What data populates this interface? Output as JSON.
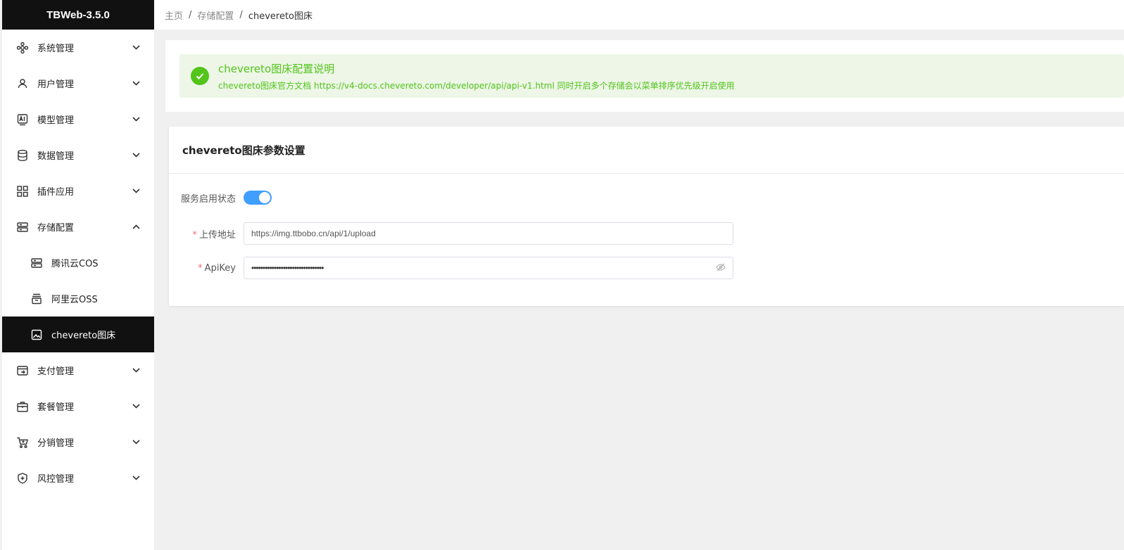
{
  "app": {
    "title": "TBWeb-3.5.0"
  },
  "sidebar": {
    "items": [
      {
        "label": "系统管理",
        "icon": "system-icon"
      },
      {
        "label": "用户管理",
        "icon": "user-icon"
      },
      {
        "label": "模型管理",
        "icon": "ai-model-icon"
      },
      {
        "label": "数据管理",
        "icon": "database-icon"
      },
      {
        "label": "插件应用",
        "icon": "grid-icon"
      },
      {
        "label": "存储配置",
        "icon": "storage-icon",
        "expanded": true,
        "children": [
          {
            "label": "腾讯云COS",
            "icon": "server-icon"
          },
          {
            "label": "阿里云OSS",
            "icon": "archive-icon"
          },
          {
            "label": "chevereto图床",
            "icon": "image-icon",
            "active": true
          }
        ]
      },
      {
        "label": "支付管理",
        "icon": "payment-icon"
      },
      {
        "label": "套餐管理",
        "icon": "package-icon"
      },
      {
        "label": "分销管理",
        "icon": "cart-icon"
      },
      {
        "label": "风控管理",
        "icon": "shield-icon"
      }
    ]
  },
  "breadcrumb": {
    "items": [
      "主页",
      "存储配置",
      "chevereto图床"
    ],
    "separator": "/"
  },
  "alert": {
    "title": "chevereto图床配置说明",
    "description": "chevereto图床官方文档 https://v4-docs.chevereto.com/developer/api/api-v1.html 同时开启多个存储会以菜单排序优先级开启使用",
    "color": "#52c41a"
  },
  "card": {
    "title": "chevereto图床参数设置",
    "fields": {
      "status": {
        "label": "服务启用状态",
        "enabled": true
      },
      "upload_url": {
        "required": "*",
        "label": "上传地址",
        "value": "https://img.ttbobo.cn/api/1/upload"
      },
      "api_key": {
        "required": "*",
        "label": "ApiKey",
        "value": "••••••••••••••••••••••••••••••••"
      }
    }
  },
  "colors": {
    "accent": "#409eff",
    "success": "#52c41a",
    "active_bg": "#111111"
  }
}
